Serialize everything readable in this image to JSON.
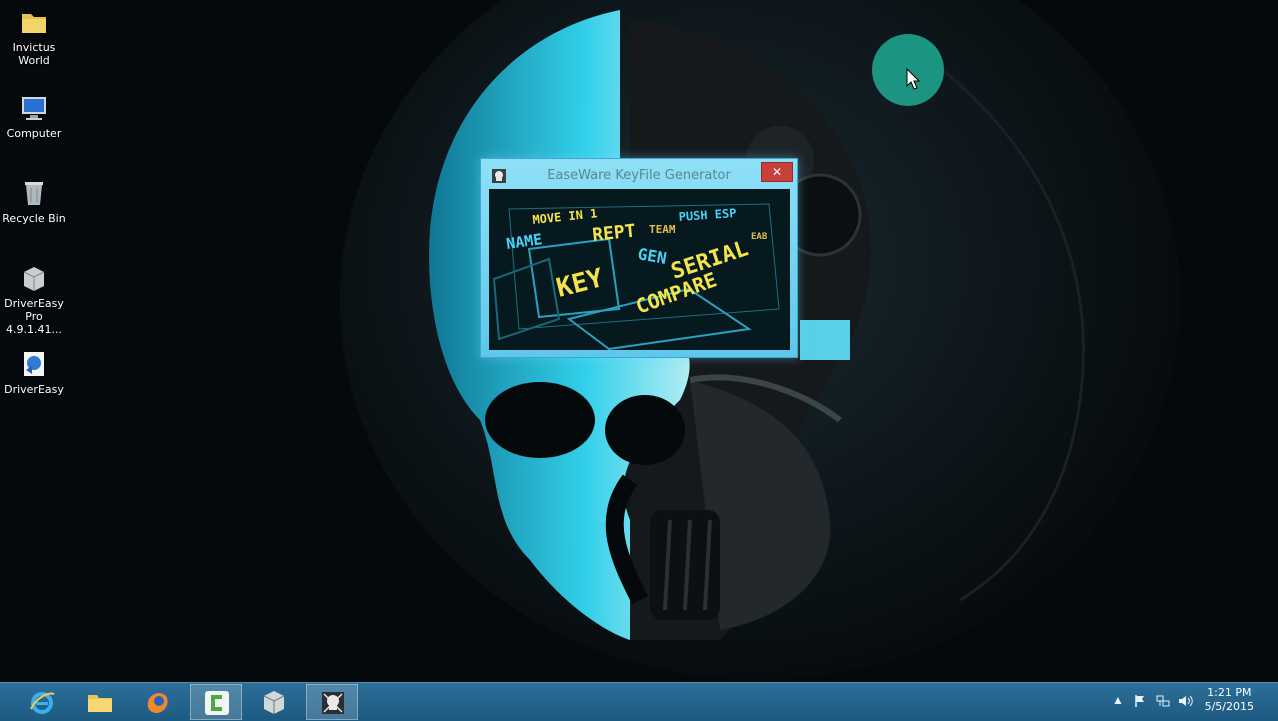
{
  "desktop": {
    "icons": [
      {
        "label": "Invictus\nWorld",
        "icon": "folder-icon"
      },
      {
        "label": "Computer",
        "icon": "computer-icon"
      },
      {
        "label": "Recycle Bin",
        "icon": "recycle-bin-icon"
      },
      {
        "label": "DriverEasy\nPro 4.9.1.41...",
        "icon": "installer-box-icon"
      },
      {
        "label": "DriverEasy",
        "icon": "drivereasy-shortcut-icon"
      }
    ]
  },
  "dialog": {
    "title": "EaseWare KeyFile Generator",
    "close_glyph": "✕",
    "banner_words": [
      "MOVE IN 1",
      "NAME",
      "REPT",
      "TEAM",
      "PUSH ESP",
      "GEN",
      "KEY",
      "SERIAL",
      "COMPARE",
      "EAB"
    ]
  },
  "taskbar": {
    "apps": [
      "internet-explorer-icon",
      "file-explorer-icon",
      "firefox-icon",
      "camtasia-icon",
      "installer-box-icon",
      "keygen-icon"
    ],
    "tray": [
      "show-hidden-icons-icon",
      "action-center-flag-icon",
      "network-icon",
      "volume-icon"
    ],
    "time": "1:21 PM",
    "date": "5/5/2015"
  },
  "colors": {
    "taskbar": "#1d5a82",
    "dialog_border": "#5fc7ea",
    "close_button": "#c7403a",
    "cursor_highlight": "#1e9b88"
  }
}
